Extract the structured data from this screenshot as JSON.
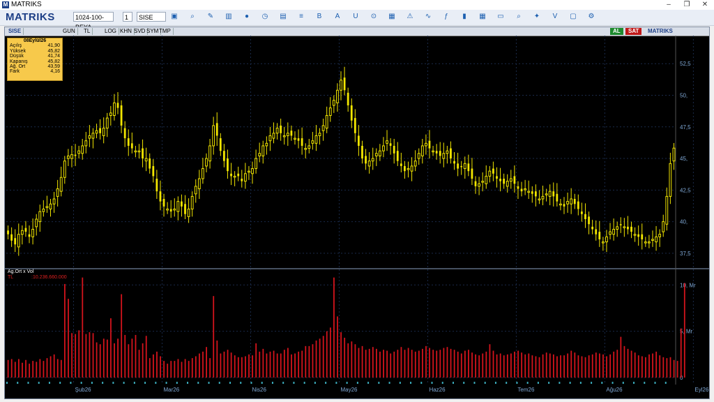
{
  "window": {
    "title": "MATRIKS",
    "minimize": "–",
    "restore": "❐",
    "close": "✕"
  },
  "toolbar": {
    "logo": "MATRIKS",
    "layout_value": "1024-100-BEYA",
    "period_value": "1",
    "symbol_value": "SISE",
    "icon_names": [
      "save-icon",
      "zoom-icon",
      "draw-icon",
      "chart-type-icon",
      "globe-icon",
      "clock-icon",
      "news-icon",
      "list-icon",
      "bold-icon",
      "font-icon",
      "underline-icon",
      "link-icon",
      "portfolio-icon",
      "alert-icon",
      "chart-icon",
      "formula-icon",
      "bars-icon",
      "calendar-icon",
      "print-icon",
      "search-icon",
      "twitter-icon",
      "video-icon",
      "window-icon",
      "settings-icon"
    ]
  },
  "chart_toolbar": {
    "symbol": "SISE",
    "buttons": [
      "GUN",
      "TL",
      "LOG",
      "KHN",
      "SVD",
      "SYM",
      "TMP"
    ],
    "buy": "AL",
    "sell": "SAT",
    "brand": "MATRIKS",
    "colors": {
      "buy": "#1e8a2e",
      "sell": "#c01818"
    }
  },
  "info_box": {
    "date": "08Eylül26",
    "rows": [
      {
        "label": "Açılış",
        "value": "41,90"
      },
      {
        "label": "Yüksek",
        "value": "45,82"
      },
      {
        "label": "Düşük",
        "value": "41,74"
      },
      {
        "label": "Kapanış",
        "value": "45,82"
      },
      {
        "label": "Ağ. Ort",
        "value": "43,59"
      },
      {
        "label": "Fark",
        "value": "4,16"
      }
    ]
  },
  "volume_panel": {
    "title": "Ag.Ort x Vol",
    "currency": "TL",
    "value": ":10.236.660.000"
  },
  "chart_data": {
    "type": "bar",
    "candle_color": "#f2e600",
    "volume_color": "#d4141c",
    "price_axis": {
      "ticks": [
        37.5,
        40,
        42.5,
        45,
        47.5,
        50,
        52.5
      ],
      "labels": [
        "37,5",
        "40,",
        "42,5",
        "45,",
        "47,5",
        "50,",
        "52,5"
      ],
      "ylim": [
        36.5,
        54.5
      ]
    },
    "volume_axis": {
      "ticks": [
        0,
        5,
        10
      ],
      "labels": [
        "0",
        "5, Mr",
        "10, Mr"
      ],
      "ylim": [
        0,
        11.3
      ],
      "unit": "Mr"
    },
    "month_labels": [
      "Şub26",
      "Mar26",
      "Nis26",
      "May26",
      "Haz26",
      "Tem26",
      "Ağu26",
      "Eyl26"
    ],
    "month_index": [
      19,
      44,
      69,
      94,
      119,
      144,
      169,
      194
    ],
    "close": [
      39.0,
      38.5,
      38.2,
      39.0,
      39.3,
      39.2,
      38.8,
      39.4,
      40.2,
      40.8,
      41.0,
      41.2,
      41.4,
      41.8,
      42.6,
      43.5,
      44.8,
      45.2,
      45.3,
      45.2,
      45.6,
      46.0,
      46.4,
      46.8,
      47.0,
      47.2,
      47.0,
      47.4,
      48.2,
      48.6,
      49.4,
      49.0,
      47.6,
      46.6,
      46.0,
      45.8,
      45.6,
      45.6,
      45.0,
      45.0,
      44.2,
      43.6,
      42.4,
      41.6,
      41.2,
      41.0,
      40.8,
      41.0,
      41.6,
      41.2,
      40.6,
      41.0,
      42.0,
      42.8,
      43.4,
      44.2,
      45.0,
      46.0,
      47.6,
      46.8,
      45.6,
      44.8,
      44.0,
      43.6,
      43.6,
      43.6,
      43.2,
      43.8,
      44.0,
      44.2,
      45.0,
      45.4,
      46.0,
      46.2,
      46.8,
      47.0,
      47.4,
      47.0,
      46.8,
      47.0,
      46.8,
      46.6,
      46.4,
      46.0,
      45.8,
      46.0,
      46.4,
      46.8,
      47.0,
      47.6,
      48.4,
      49.0,
      49.6,
      50.4,
      51.2,
      50.4,
      49.2,
      48.0,
      47.0,
      46.0,
      45.0,
      44.6,
      44.8,
      45.0,
      45.4,
      45.6,
      46.0,
      46.4,
      46.0,
      45.4,
      44.8,
      44.4,
      44.0,
      44.2,
      44.4,
      44.8,
      45.4,
      46.0,
      46.2,
      45.8,
      45.6,
      45.4,
      45.2,
      45.4,
      45.6,
      45.0,
      44.6,
      44.2,
      44.4,
      44.6,
      44.0,
      43.4,
      42.8,
      43.0,
      43.2,
      43.6,
      44.0,
      43.8,
      43.4,
      43.2,
      43.0,
      43.2,
      43.4,
      43.0,
      42.6,
      42.4,
      42.6,
      42.4,
      42.2,
      42.0,
      41.8,
      42.0,
      42.2,
      42.4,
      42.0,
      41.6,
      41.4,
      41.2,
      41.6,
      41.8,
      41.4,
      41.0,
      40.6,
      40.2,
      39.8,
      39.4,
      39.0,
      38.6,
      38.4,
      38.8,
      39.2,
      39.4,
      39.6,
      39.8,
      39.6,
      39.4,
      39.2,
      39.0,
      38.8,
      38.6,
      38.4,
      38.4,
      38.6,
      38.8,
      39.0,
      40.0,
      42.0,
      44.6,
      45.82
    ],
    "volume": [
      1.9,
      2.0,
      1.7,
      2.0,
      1.6,
      1.9,
      1.5,
      1.8,
      1.7,
      2.0,
      1.8,
      2.1,
      2.3,
      2.5,
      2.0,
      1.9,
      10.1,
      8.5,
      4.8,
      4.7,
      5.1,
      10.8,
      4.7,
      4.9,
      4.8,
      3.8,
      3.6,
      4.2,
      4.1,
      6.4,
      3.7,
      4.2,
      9.0,
      4.6,
      3.6,
      4.2,
      4.6,
      3.0,
      3.7,
      4.5,
      2.1,
      2.5,
      2.8,
      2.3,
      1.8,
      1.5,
      1.8,
      1.8,
      2.0,
      1.7,
      2.0,
      1.8,
      2.1,
      2.3,
      2.6,
      2.8,
      3.3,
      2.1,
      8.8,
      4.0,
      2.6,
      2.8,
      3.0,
      2.7,
      2.4,
      2.2,
      2.2,
      2.3,
      2.5,
      2.4,
      3.7,
      2.8,
      3.1,
      2.6,
      2.8,
      2.9,
      2.6,
      2.6,
      3.0,
      3.2,
      2.5,
      2.6,
      2.8,
      2.9,
      3.4,
      3.4,
      3.6,
      4.0,
      4.2,
      4.5,
      5.0,
      5.4,
      10.8,
      6.6,
      4.9,
      4.3,
      3.7,
      3.9,
      3.6,
      3.2,
      3.4,
      3.0,
      3.1,
      3.3,
      3.1,
      2.8,
      3.0,
      2.9,
      2.6,
      2.8,
      3.0,
      3.3,
      3.0,
      3.2,
      3.0,
      2.8,
      2.9,
      3.1,
      3.4,
      3.2,
      3.0,
      2.9,
      3.0,
      3.2,
      3.3,
      3.1,
      3.0,
      2.8,
      2.6,
      2.9,
      3.0,
      2.7,
      2.5,
      2.4,
      2.6,
      2.8,
      3.6,
      2.9,
      2.5,
      2.6,
      2.4,
      2.5,
      2.6,
      2.8,
      2.9,
      2.7,
      2.5,
      2.6,
      2.4,
      2.3,
      2.2,
      2.5,
      2.7,
      2.6,
      2.5,
      2.3,
      2.4,
      2.4,
      2.6,
      2.9,
      2.7,
      2.4,
      2.3,
      2.2,
      2.4,
      2.5,
      2.7,
      2.6,
      2.5,
      2.3,
      2.5,
      2.8,
      3.0,
      4.4,
      3.4,
      3.1,
      2.9,
      2.7,
      2.4,
      2.3,
      2.2,
      2.5,
      2.6,
      2.8,
      2.4,
      2.2,
      2.1,
      2.2,
      1.9,
      1.8,
      5.3,
      10.2
    ]
  }
}
